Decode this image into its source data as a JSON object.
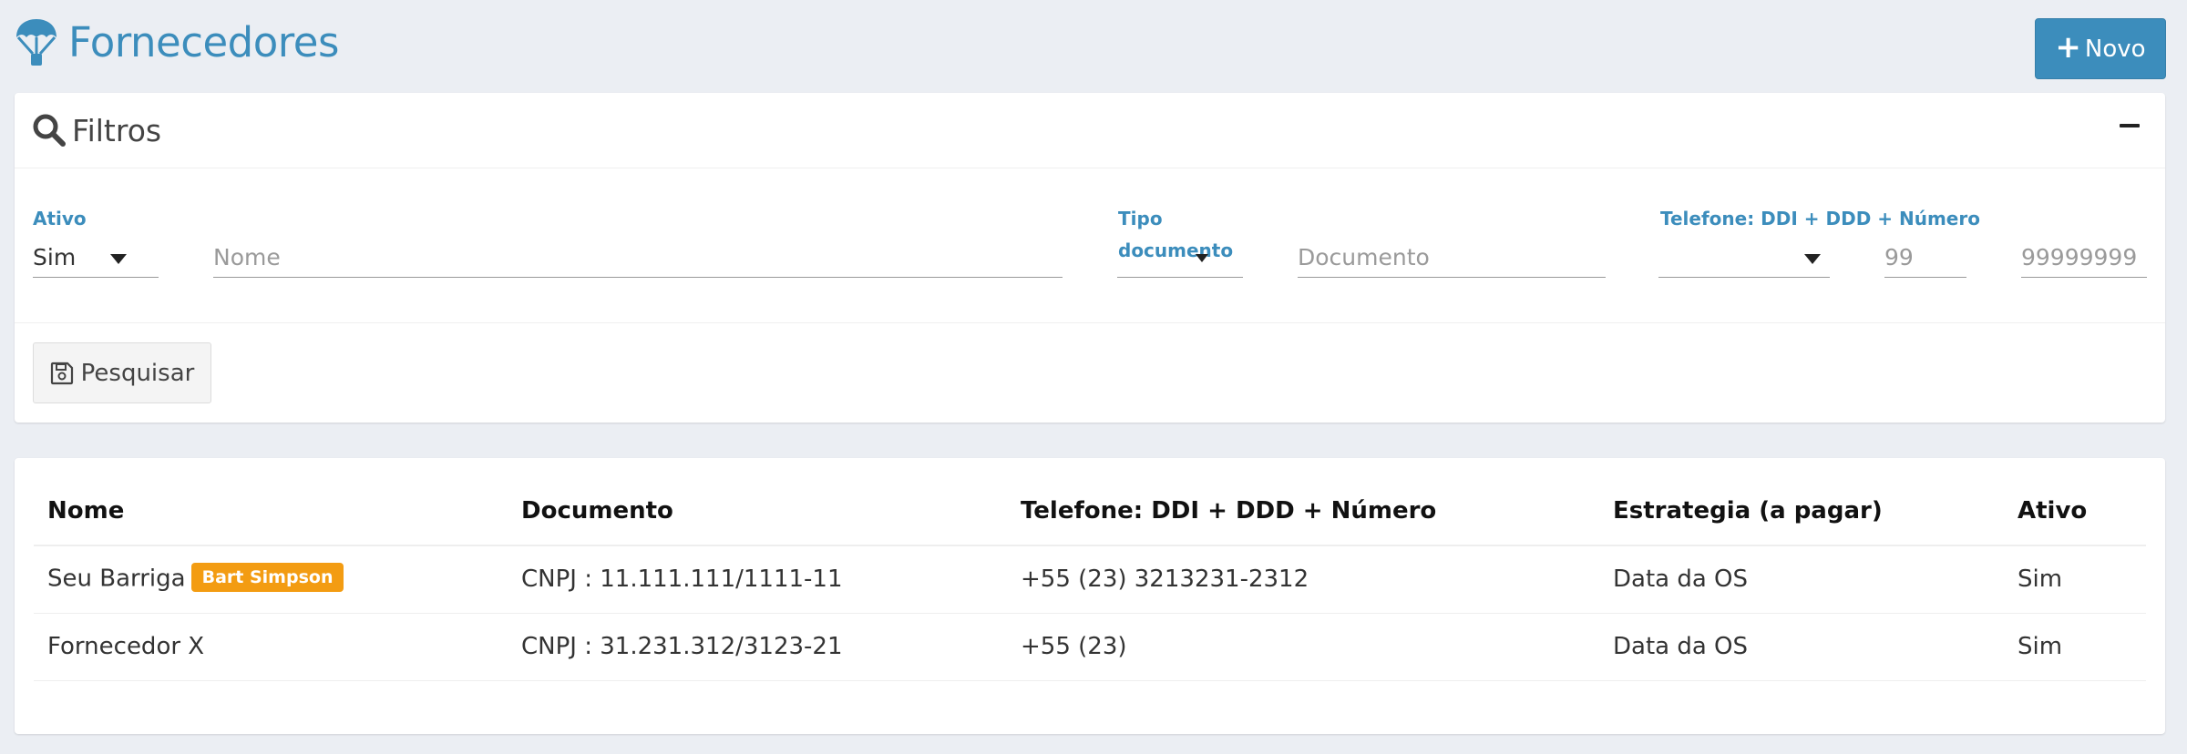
{
  "page": {
    "title": "Fornecedores",
    "logo_icon": "parachute-icon",
    "new_button_label": "Novo",
    "brand_color": "#3c8dbc"
  },
  "filters": {
    "title": "Filtros",
    "search_icon": "search-icon",
    "collapse_icon": "minus-icon",
    "ativo": {
      "label": "Ativo",
      "value": "Sim"
    },
    "nome": {
      "placeholder": "Nome",
      "value": ""
    },
    "tipo_documento": {
      "label_line1": "Tipo",
      "label_line2": "documento",
      "value": ""
    },
    "documento": {
      "placeholder": "Documento",
      "value": ""
    },
    "telefone": {
      "label": "Telefone: DDI + DDD + Número",
      "ddi_value": "",
      "ddd_placeholder": "99",
      "numero_placeholder": "99999999"
    },
    "search_button_label": "Pesquisar",
    "search_button_icon": "floppy-disk-icon"
  },
  "table": {
    "headers": [
      "Nome",
      "Documento",
      "Telefone: DDI + DDD + Número",
      "Estrategia (a pagar)",
      "Ativo"
    ],
    "rows": [
      {
        "nome": "Seu Barriga",
        "badge": "Bart Simpson",
        "documento": "CNPJ : 11.111.111/1111-11",
        "telefone": "+55 (23) 3213231-2312",
        "estrategia": "Data da OS",
        "ativo": "Sim"
      },
      {
        "nome": "Fornecedor X",
        "badge": "",
        "documento": "CNPJ : 31.231.312/3123-21",
        "telefone": "+55 (23)",
        "estrategia": "Data da OS",
        "ativo": "Sim"
      }
    ],
    "badge_color": "#f39c12"
  }
}
